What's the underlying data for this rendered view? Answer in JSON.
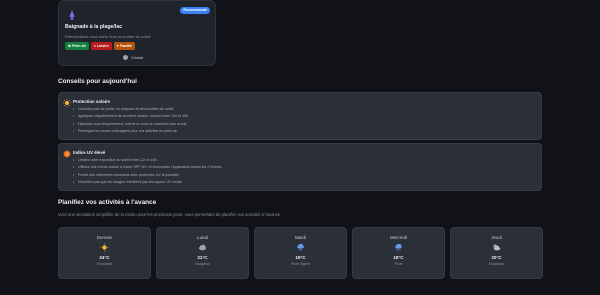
{
  "activity": {
    "badge": "Recommandé",
    "title": "Baignade à la plage/lac",
    "description": "Rafraîchissez-vous dans l'eau et profitez du soleil.",
    "tags": [
      {
        "label": "Plein air",
        "tone": "green"
      },
      {
        "label": "Loisirs",
        "tone": "red"
      },
      {
        "label": "Famille",
        "tone": "orange"
      }
    ],
    "choose_label": "Choisir"
  },
  "tips": {
    "section_title": "Conseils pour aujourd'hui",
    "cards": [
      {
        "title": "Protection solaire",
        "icon": "sun-icon",
        "items": [
          "N'oubliez pas de porter un chapeau et des lunettes de soleil.",
          "Appliquez régulièrement de la crème solaire, surtout entre 11h et 16h.",
          "Hydratez-vous fréquemment, même si vous ne ressentez pas la soif.",
          "Privilégiez les zones ombragées pour vos activités en plein air."
        ]
      },
      {
        "title": "Indice UV élevé",
        "icon": "uv-icon",
        "items": [
          "Limitez votre exposition au soleil entre 11h et 16h.",
          "Utilisez une crème solaire à indice SPF 30+ et renouvelez l'application toutes les 2 heures.",
          "Portez des vêtements couvrants avec protection UV si possible.",
          "N'oubliez pas que les nuages n'arrêtent pas les rayons UV nocifs."
        ]
      }
    ]
  },
  "plan": {
    "section_title": "Planifiez vos activités à l'avance",
    "description": "Voici une simulation simplifiée de la météo pour les prochains jours, vous permettant de planifier vos activités à l'avance.",
    "days": [
      {
        "name": "Demain",
        "icon": "sun-icon",
        "temp": "24°C",
        "condition": "Ensoleillé"
      },
      {
        "name": "Lundi",
        "icon": "cloud-icon",
        "temp": "21°C",
        "condition": "Nuageux"
      },
      {
        "name": "Mardi",
        "icon": "rain-icon",
        "temp": "19°C",
        "condition": "Pluie légère"
      },
      {
        "name": "Mercredi",
        "icon": "rain-icon",
        "temp": "18°C",
        "condition": "Pluie"
      },
      {
        "name": "Jeudi",
        "icon": "partly-cloudy-icon",
        "temp": "20°C",
        "condition": "Éclaircies"
      }
    ]
  },
  "colors": {
    "accent": "#3b82f6",
    "background": "#101217",
    "card": "#2a2f38"
  }
}
